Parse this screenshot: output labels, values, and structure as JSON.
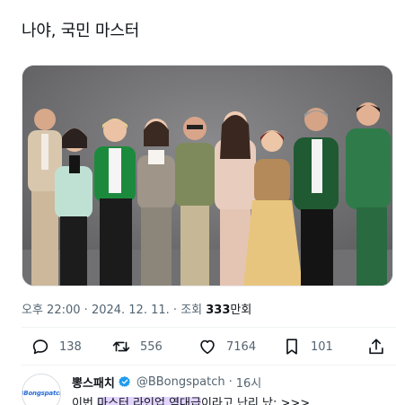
{
  "tweet": {
    "text": "나야, 국민 마스터"
  },
  "meta": {
    "time": "오후 22:00",
    "sep1": " · ",
    "date": "2024. 12. 11.",
    "sep2": " · ",
    "views_label": "조회 ",
    "views_count": "333",
    "views_unit": "만회"
  },
  "actions": {
    "replies": "138",
    "retweets": "556",
    "likes": "7164",
    "bookmarks": "101"
  },
  "reply": {
    "avatar_text": "BBongspatch",
    "name": "뽕스패치",
    "handle": "@BBongspatch",
    "dot": "·",
    "time": "16시",
    "body_pre": "이번 ",
    "body_highlight": "마스터 라인업 역대급",
    "body_post": "이라고 난리 났; >>>"
  },
  "colors": {
    "accent": "#1d9bf0",
    "muted": "#536471",
    "highlight": "#e2d4ff"
  },
  "icons": [
    "reply-icon",
    "retweet-icon",
    "like-icon",
    "bookmark-icon",
    "share-icon",
    "verified-icon"
  ]
}
